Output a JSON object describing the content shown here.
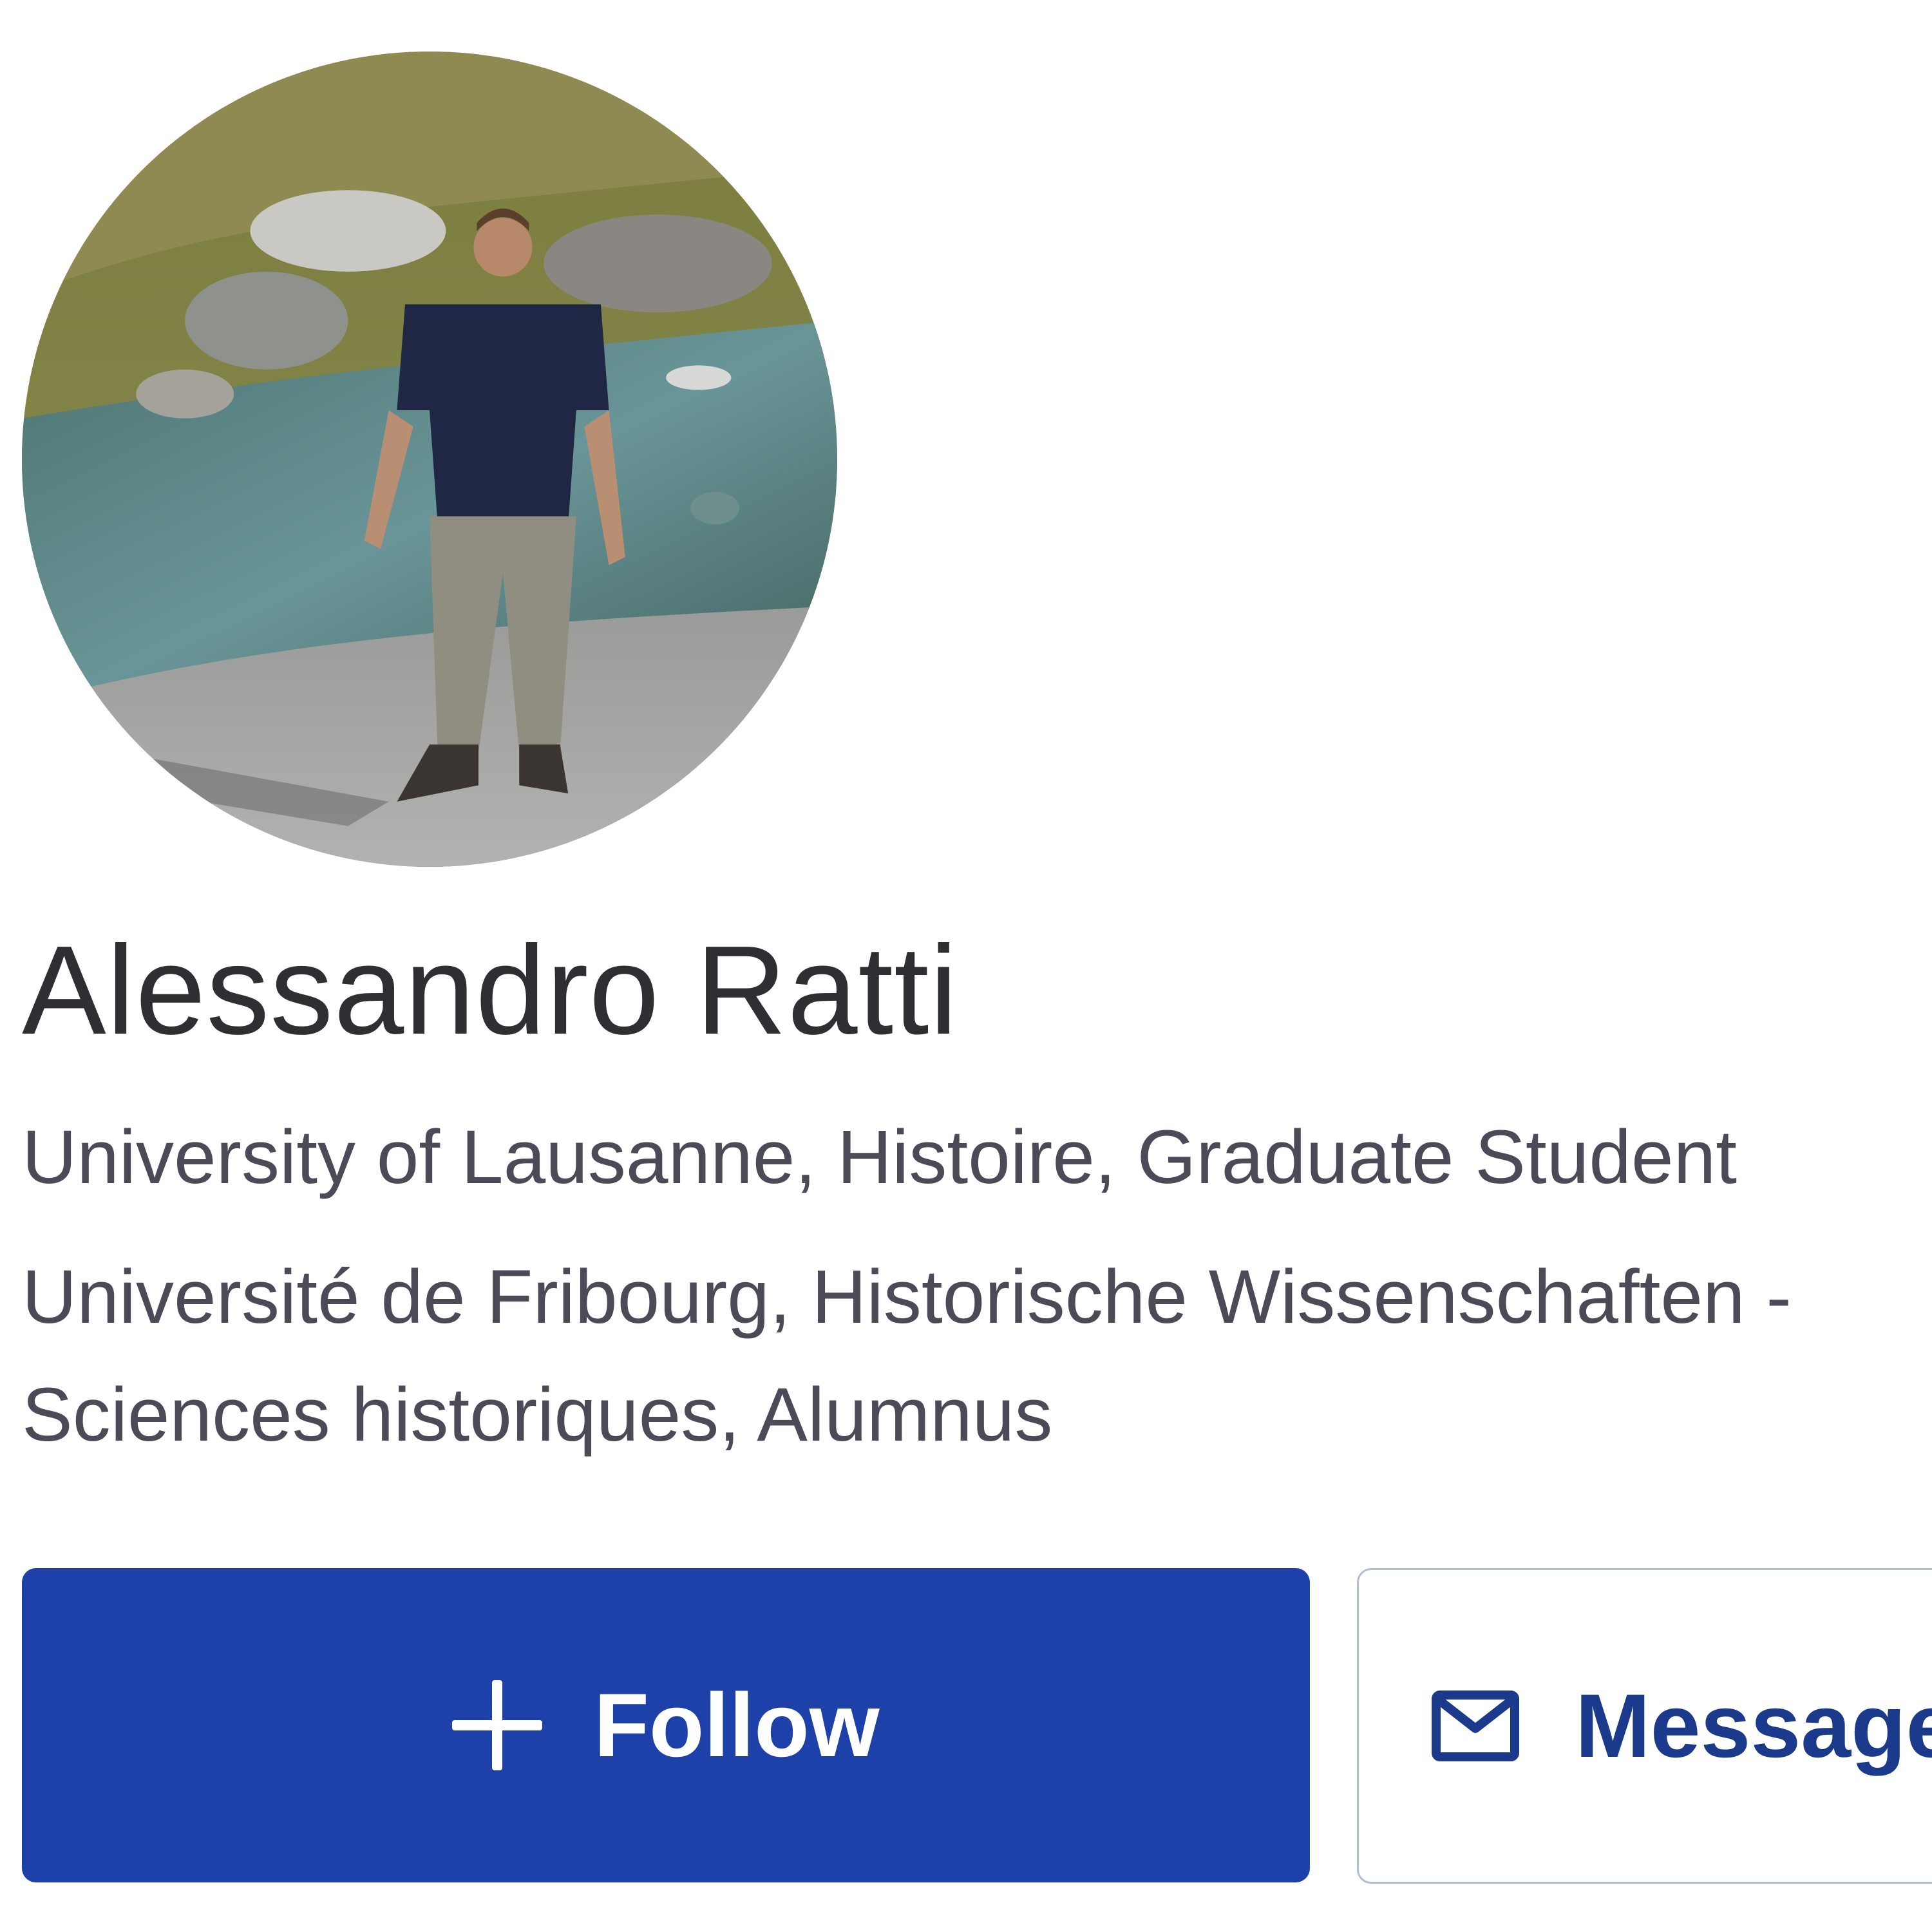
{
  "profile": {
    "name": "Alessandro Ratti",
    "affiliations": [
      "University of Lausanne, Histoire, Graduate Student",
      "Université de Fribourg, Historische Wissenschaften -",
      "Sciences historiques, Alumnus"
    ],
    "avatar_alt": "Alessandro Ratti"
  },
  "actions": {
    "follow_label": "Follow",
    "message_label": "Message"
  },
  "colors": {
    "follow_bg": "#1d41a9",
    "message_text": "#1c3a8c",
    "name_text": "#2e2e33",
    "secondary_text": "#4b4b57"
  },
  "icons": {
    "follow": "plus-icon",
    "message": "mail-icon"
  }
}
